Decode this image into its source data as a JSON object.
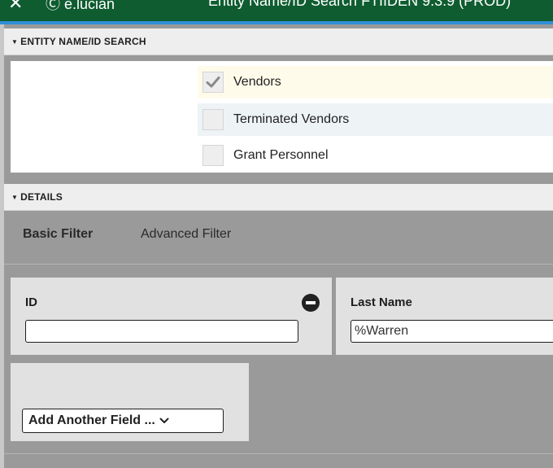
{
  "header": {
    "close_glyph": "✕",
    "user": "Ⓒ e.lucian",
    "title": "Entity Name/ID Search FTIIDEN 9.3.9 (PROD)",
    "bg_color": "#0e5c30",
    "accent_color": "#2f8fd8"
  },
  "entity_section": {
    "title": "ENTITY NAME/ID SEARCH",
    "checkboxes": [
      {
        "label": "Vendors",
        "checked": true,
        "row_bg": "#fffbea"
      },
      {
        "label": "Terminated Vendors",
        "checked": false,
        "row_bg": "#eef3f6"
      },
      {
        "label": "Grant Personnel",
        "checked": false,
        "row_bg": "#ffffff"
      }
    ]
  },
  "details_section": {
    "title": "DETAILS",
    "tabs": {
      "basic": "Basic Filter",
      "advanced": "Advanced Filter"
    },
    "fields": {
      "id": {
        "label": "ID",
        "value": ""
      },
      "last_name": {
        "label": "Last Name",
        "value": "%Warren"
      }
    },
    "add_field": {
      "label": "Add Another Field ..."
    }
  },
  "icons": {
    "section_caret": "caret-down-icon",
    "remove_field": "minus-circle-icon",
    "checkbox_check": "check-icon",
    "select_chevron": "chevron-down-icon"
  }
}
